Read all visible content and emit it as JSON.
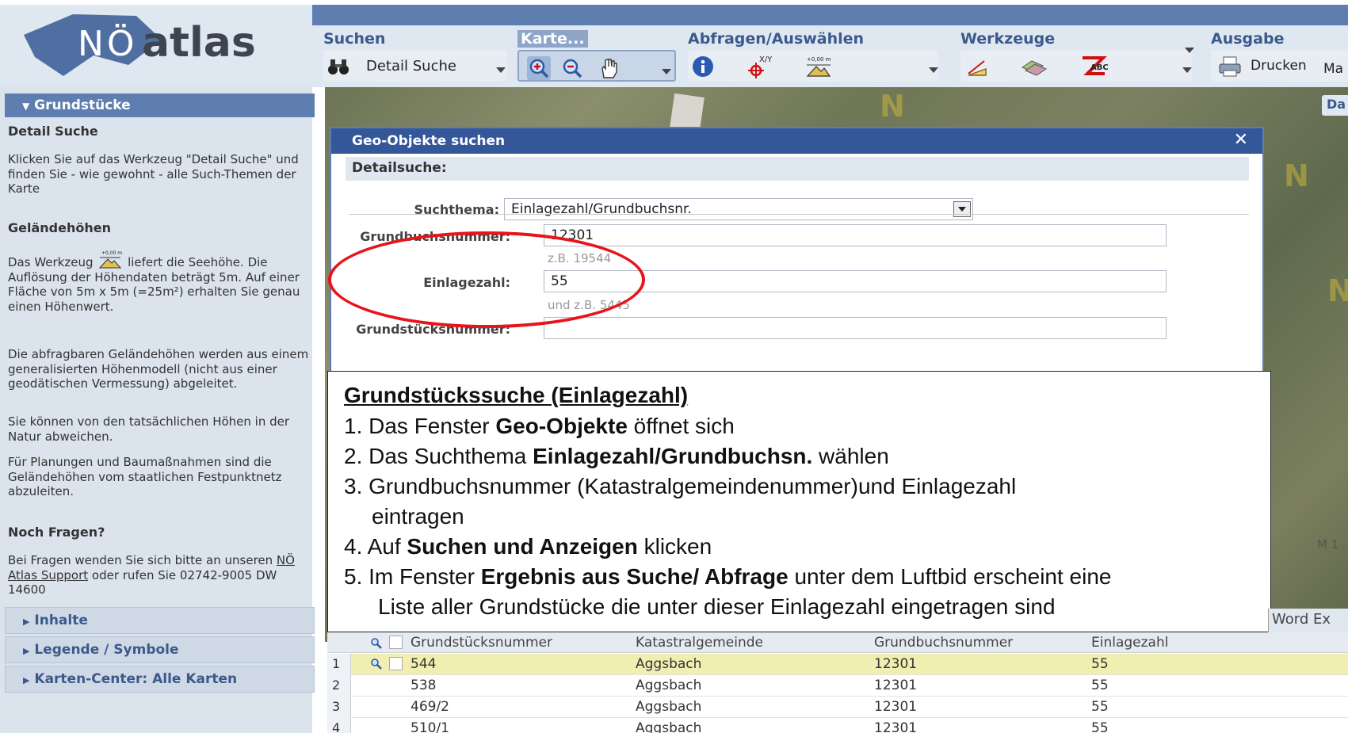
{
  "brand": {
    "prefix": "NÖ",
    "name": "atlas"
  },
  "toolbar": {
    "suchen": {
      "label": "Suchen",
      "detail_suche": "Detail Suche"
    },
    "karte": {
      "label": "Karte..."
    },
    "abfragen": {
      "label": "Abfragen/Auswählen",
      "xy_label": "X/Y",
      "height_label": "+0,00 m"
    },
    "werkzeuge": {
      "label": "Werkzeuge",
      "abc_label": "ABC"
    },
    "ausgabe": {
      "label": "Ausgabe",
      "drucken": "Drucken",
      "more": "Ma"
    }
  },
  "sidebar": {
    "header": "Grundstücke",
    "detail_title": "Detail Suche",
    "detail_text": "Klicken Sie auf das Werkzeug \"Detail Suche\" und finden Sie - wie gewohnt - alle Such-Themen der Karte",
    "gelaende_title": "Geländehöhen",
    "gelaende_p1a": "Das Werkzeug",
    "gelaende_p1b": "liefert die Seehöhe. Die Auflösung der Höhendaten beträgt 5m. Auf einer Fläche von 5m x 5m (=25m²) erhalten Sie genau einen Höhenwert.",
    "gelaende_p2": "Die abfragbaren Geländehöhen werden aus einem generalisierten Höhenmodell (nicht aus einer geodätischen Vermessung) abgeleitet.",
    "gelaende_p3": "Sie können von den tatsächlichen Höhen in der Natur abweichen.",
    "gelaende_p4": "Für Planungen und Baumaßnahmen sind die Geländehöhen vom staatlichen Festpunktnetz abzuleiten.",
    "fragen_title": "Noch Fragen?",
    "fragen_a": "Bei Fragen wenden Sie sich bitte an unseren",
    "fragen_link": "NÖ Atlas Support",
    "fragen_b": "oder rufen Sie 02742-9005 DW 14600",
    "acc_inhalte": "Inhalte",
    "acc_legende": "Legende / Symbole",
    "acc_karten": "Karten-Center: Alle Karten"
  },
  "map": {
    "tab": "Da",
    "scale": "M 1"
  },
  "dialog": {
    "title": "Geo-Objekte suchen",
    "section": "Detailsuche:",
    "suchthema_label": "Suchthema:",
    "suchthema_value": "Einlagezahl/Grundbuchsnr.",
    "grundbuch_label": "Grundbuchsnummer:",
    "grundbuch_value": "12301",
    "grundbuch_hint": "z.B. 19544",
    "einlage_label": "Einlagezahl:",
    "einlage_value": "55",
    "einlage_hint": "und z.B. 5445",
    "grundstueck_label": "Grundstücksnummer:",
    "grundstueck_value": ""
  },
  "instructions": {
    "heading": "Grundstückssuche (Einlagezahl)",
    "s1a": "1.  Das Fenster ",
    "s1b": "Geo-Objekte",
    "s1c": " öffnet sich",
    "s2a": "2.  Das Suchthema ",
    "s2b": "Einlagezahl/Grundbuchsn.",
    "s2c": " wählen",
    "s3a": "3.  Grundbuchsnummer (Katastralgemeindenummer)und Einlagezahl",
    "s3b": "eintragen",
    "s4a": "4.  Auf ",
    "s4b": "Suchen und Anzeigen",
    "s4c": " klicken",
    "s5a": "5.  Im Fenster  ",
    "s5b": "Ergebnis aus Suche/ Abfrage",
    "s5c": " unter dem Luftbid erscheint eine",
    "s5d": "Liste aller Grundstücke die unter dieser  Einlagezahl eingetragen sind"
  },
  "results": {
    "export_label": "Word Ex",
    "columns": [
      "Grundstücksnummer",
      "Katastralgemeinde",
      "Grundbuchsnummer",
      "Einlagezahl"
    ],
    "rows": [
      {
        "n": "1",
        "gst": "544",
        "kg": "Aggsbach",
        "gb": "12301",
        "ez": "55"
      },
      {
        "n": "2",
        "gst": "538",
        "kg": "Aggsbach",
        "gb": "12301",
        "ez": "55"
      },
      {
        "n": "3",
        "gst": "469/2",
        "kg": "Aggsbach",
        "gb": "12301",
        "ez": "55"
      },
      {
        "n": "4",
        "gst": "510/1",
        "kg": "Aggsbach",
        "gb": "12301",
        "ez": "55"
      }
    ]
  },
  "colors": {
    "accent": "#34579a",
    "header": "#5f7eb0",
    "highlight": "#e8141c"
  }
}
